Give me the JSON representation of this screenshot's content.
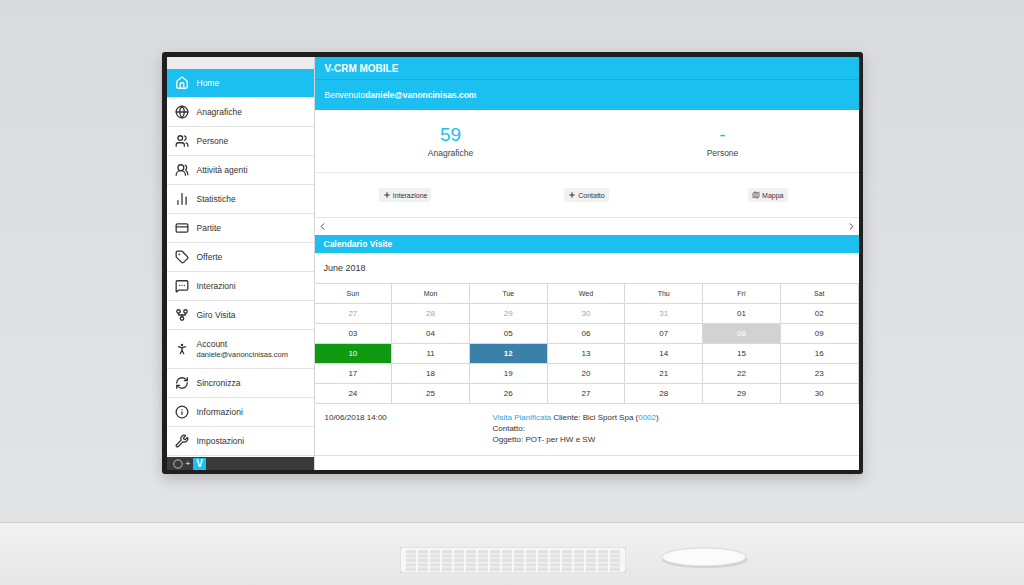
{
  "app": {
    "title": "V-CRM MOBILE",
    "welcome_prefix": "Benvenuto",
    "welcome_user": "daniele@vanoncinisas.com"
  },
  "sidebar": {
    "items": [
      {
        "label": "Home",
        "sub": "",
        "selected": true
      },
      {
        "label": "Anagrafiche",
        "sub": "",
        "selected": false
      },
      {
        "label": "Persone",
        "sub": "",
        "selected": false
      },
      {
        "label": "Attività agenti",
        "sub": "",
        "selected": false
      },
      {
        "label": "Statistiche",
        "sub": "",
        "selected": false
      },
      {
        "label": "Partite",
        "sub": "",
        "selected": false
      },
      {
        "label": "Offerte",
        "sub": "",
        "selected": false
      },
      {
        "label": "Interazioni",
        "sub": "",
        "selected": false
      },
      {
        "label": "Giro Visita",
        "sub": "",
        "selected": false
      },
      {
        "label": "Account",
        "sub": "daniele@vanoncinisas.com",
        "selected": false
      },
      {
        "label": "Sincronizza",
        "sub": "",
        "selected": false
      },
      {
        "label": "Informazioni",
        "sub": "",
        "selected": false
      },
      {
        "label": "Impostazioni",
        "sub": "",
        "selected": false
      }
    ],
    "logo": {
      "joiner": "+",
      "mark": "V"
    }
  },
  "stats": [
    {
      "value": "59",
      "label": "Anagrafiche"
    },
    {
      "value": "-",
      "label": "Persone"
    }
  ],
  "actions": [
    {
      "label": "Interazione",
      "kind": "plus"
    },
    {
      "label": "Contatto",
      "kind": "plus"
    },
    {
      "label": "Mappa",
      "kind": "map"
    }
  ],
  "calendar": {
    "title": "Calendario Visite",
    "month": "June 2018",
    "weekdays": [
      "Sun",
      "Mon",
      "Tue",
      "Wed",
      "Thu",
      "Fri",
      "Sat"
    ],
    "weeks": [
      [
        {
          "label": "27",
          "outside": true,
          "selected": false,
          "color": null
        },
        {
          "label": "28",
          "outside": true,
          "selected": false,
          "color": null
        },
        {
          "label": "29",
          "outside": true,
          "selected": false,
          "color": null
        },
        {
          "label": "30",
          "outside": true,
          "selected": false,
          "color": null
        },
        {
          "label": "31",
          "outside": true,
          "selected": false,
          "color": null
        },
        {
          "label": "01",
          "outside": false,
          "selected": false,
          "color": null
        },
        {
          "label": "02",
          "outside": false,
          "selected": false,
          "color": null
        }
      ],
      [
        {
          "label": "03",
          "outside": false,
          "selected": false,
          "color": null
        },
        {
          "label": "04",
          "outside": false,
          "selected": false,
          "color": null
        },
        {
          "label": "05",
          "outside": false,
          "selected": false,
          "color": null
        },
        {
          "label": "06",
          "outside": false,
          "selected": false,
          "color": null
        },
        {
          "label": "07",
          "outside": false,
          "selected": false,
          "color": null
        },
        {
          "label": "08",
          "outside": false,
          "selected": false,
          "color": "#d2d2d2"
        },
        {
          "label": "09",
          "outside": false,
          "selected": false,
          "color": null
        }
      ],
      [
        {
          "label": "10",
          "outside": false,
          "selected": false,
          "color": "#0f9a12"
        },
        {
          "label": "11",
          "outside": false,
          "selected": false,
          "color": null
        },
        {
          "label": "12",
          "outside": false,
          "selected": true,
          "color": "#3b80a8"
        },
        {
          "label": "13",
          "outside": false,
          "selected": false,
          "color": null
        },
        {
          "label": "14",
          "outside": false,
          "selected": false,
          "color": null
        },
        {
          "label": "15",
          "outside": false,
          "selected": false,
          "color": null
        },
        {
          "label": "16",
          "outside": false,
          "selected": false,
          "color": null
        }
      ],
      [
        {
          "label": "17",
          "outside": false,
          "selected": false,
          "color": null
        },
        {
          "label": "18",
          "outside": false,
          "selected": false,
          "color": null
        },
        {
          "label": "19",
          "outside": false,
          "selected": false,
          "color": null
        },
        {
          "label": "20",
          "outside": false,
          "selected": false,
          "color": null
        },
        {
          "label": "21",
          "outside": false,
          "selected": false,
          "color": null
        },
        {
          "label": "22",
          "outside": false,
          "selected": false,
          "color": null
        },
        {
          "label": "23",
          "outside": false,
          "selected": false,
          "color": null
        }
      ],
      [
        {
          "label": "24",
          "outside": false,
          "selected": false,
          "color": null
        },
        {
          "label": "25",
          "outside": false,
          "selected": false,
          "color": null
        },
        {
          "label": "26",
          "outside": false,
          "selected": false,
          "color": null
        },
        {
          "label": "27",
          "outside": false,
          "selected": false,
          "color": null
        },
        {
          "label": "28",
          "outside": false,
          "selected": false,
          "color": null
        },
        {
          "label": "29",
          "outside": false,
          "selected": false,
          "color": null
        },
        {
          "label": "30",
          "outside": false,
          "selected": false,
          "color": null
        }
      ]
    ]
  },
  "events": [
    {
      "datetime": "10/06/2018 14:00",
      "lines": [
        [
          {
            "text": "Visita Pianificata",
            "link": true
          },
          {
            "text": " Cliente: Bici Sport Spa (",
            "link": false
          },
          {
            "text": "0002",
            "link": true
          },
          {
            "text": ")",
            "link": false
          }
        ],
        [
          {
            "text": "Contatto:",
            "link": false
          }
        ],
        [
          {
            "text": "Oggetto: POT- per HW e SW",
            "link": false
          }
        ]
      ]
    }
  ]
}
